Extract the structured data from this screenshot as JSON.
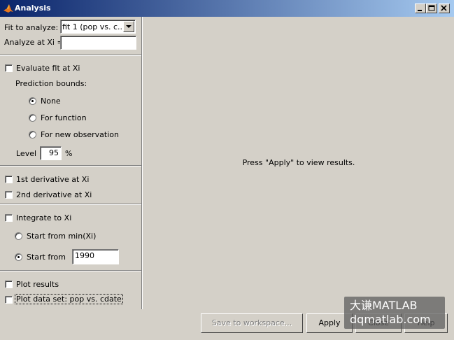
{
  "window": {
    "title": "Analysis"
  },
  "left": {
    "fit_label": "Fit to analyze:",
    "fit_value": "fit 1 (pop vs. c...",
    "analyze_label": "Analyze at Xi =",
    "analyze_value": "",
    "evaluate_label": "Evaluate fit at Xi",
    "bounds_label": "Prediction bounds:",
    "bounds_options": [
      "None",
      "For function",
      "For new observation"
    ],
    "level_label": "Level",
    "level_value": "95",
    "percent": "%",
    "deriv1_label": "1st derivative at Xi",
    "deriv2_label": "2nd derivative at Xi",
    "integrate_label": "Integrate to Xi",
    "start_min_label": "Start from min(Xi)",
    "start_from_label": "Start from",
    "start_from_value": "1990",
    "plot_results_label": "Plot results",
    "plot_dataset_label": "Plot data set: pop vs. cdate"
  },
  "right": {
    "message": "Press \"Apply\" to view results."
  },
  "buttons": {
    "save": "Save to workspace...",
    "apply": "Apply",
    "close": "Close",
    "help": "Help"
  },
  "watermark": {
    "line1": "大谦MATLAB",
    "line2": "dqmatlab.com"
  }
}
